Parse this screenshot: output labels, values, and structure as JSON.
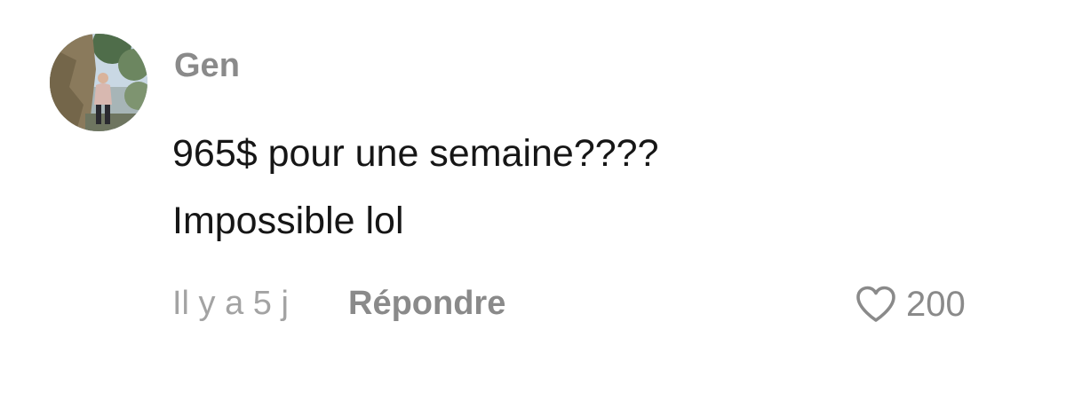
{
  "comment": {
    "username": "Gen",
    "text_line1": "965$ pour une semaine????",
    "text_line2": "Impossible lol",
    "timestamp": "Il y a 5 j",
    "reply_label": "Répondre",
    "like_count": "200",
    "icons": {
      "avatar": "profile-photo",
      "like": "heart-outline-icon"
    },
    "colors": {
      "username": "#8a8a8a",
      "text": "#161616",
      "meta": "#a3a3a3"
    }
  }
}
